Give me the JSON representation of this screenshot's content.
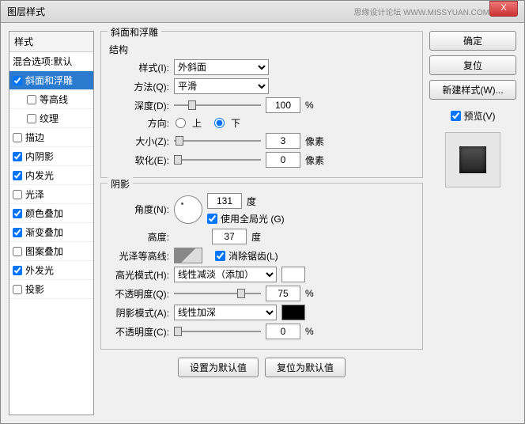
{
  "title": "图层样式",
  "watermark": "思缘设计论坛  WWW.MISSYUAN.COM",
  "close": "X",
  "side": {
    "hdr": "样式",
    "blend": "混合选项:默认",
    "items": [
      {
        "label": "斜面和浮雕",
        "checked": true,
        "sel": true
      },
      {
        "label": "等高线",
        "checked": false,
        "sub": true
      },
      {
        "label": "纹理",
        "checked": false,
        "sub": true
      },
      {
        "label": "描边",
        "checked": false
      },
      {
        "label": "内阴影",
        "checked": true
      },
      {
        "label": "内发光",
        "checked": true
      },
      {
        "label": "光泽",
        "checked": false
      },
      {
        "label": "颜色叠加",
        "checked": true
      },
      {
        "label": "渐变叠加",
        "checked": true
      },
      {
        "label": "图案叠加",
        "checked": false
      },
      {
        "label": "外发光",
        "checked": true
      },
      {
        "label": "投影",
        "checked": false
      }
    ]
  },
  "main": {
    "groupTitle": "斜面和浮雕",
    "struct": {
      "title": "结构",
      "styleLbl": "样式(I):",
      "styleVal": "外斜面",
      "methodLbl": "方法(Q):",
      "methodVal": "平滑",
      "depthLbl": "深度(D):",
      "depthVal": "100",
      "pct": "%",
      "dirLbl": "方向:",
      "up": "上",
      "down": "下",
      "sizeLbl": "大小(Z):",
      "sizeVal": "3",
      "px": "像素",
      "softLbl": "软化(E):",
      "softVal": "0"
    },
    "shade": {
      "title": "阴影",
      "angleLbl": "角度(N):",
      "angleVal": "131",
      "deg": "度",
      "globalLbl": "使用全局光 (G)",
      "altLbl": "高度:",
      "altVal": "37",
      "glossLbl": "光泽等高线:",
      "aaLbl": "消除锯齿(L)",
      "hiLbl": "高光模式(H):",
      "hiVal": "线性减淡（添加）",
      "hiOpLbl": "不透明度(Q):",
      "hiOpVal": "75",
      "shLbl": "阴影模式(A):",
      "shVal": "线性加深",
      "shOpLbl": "不透明度(C):",
      "shOpVal": "0"
    },
    "defBtn": "设置为默认值",
    "resBtn": "复位为默认值"
  },
  "right": {
    "ok": "确定",
    "cancel": "复位",
    "new": "新建样式(W)...",
    "prevLbl": "预览(V)"
  }
}
